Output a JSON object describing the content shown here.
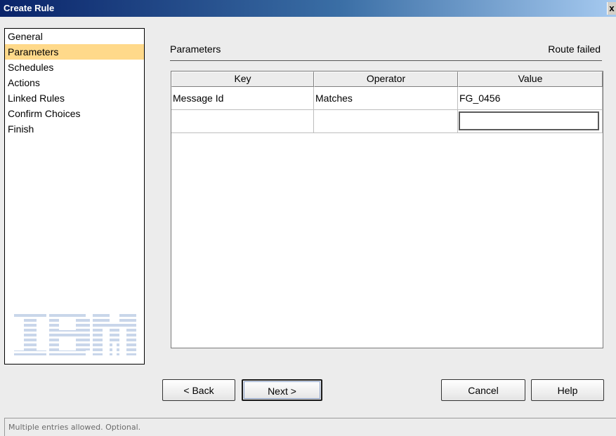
{
  "window": {
    "title": "Create Rule",
    "close_label": "x"
  },
  "nav": {
    "items": [
      {
        "label": "General"
      },
      {
        "label": "Parameters"
      },
      {
        "label": "Schedules"
      },
      {
        "label": "Actions"
      },
      {
        "label": "Linked Rules"
      },
      {
        "label": "Confirm Choices"
      },
      {
        "label": "Finish"
      }
    ],
    "selected": "Parameters",
    "logo": "IBM"
  },
  "section": {
    "title": "Parameters",
    "status": "Route failed"
  },
  "table": {
    "columns": [
      "Key",
      "Operator",
      "Value"
    ],
    "rows": [
      {
        "key": "Message Id",
        "operator": "Matches",
        "value": "FG_0456"
      },
      {
        "key": "",
        "operator": "",
        "value": ""
      }
    ]
  },
  "buttons": {
    "back": "< Back",
    "next": "Next >",
    "cancel": "Cancel",
    "help": "Help"
  },
  "status_bar": {
    "text": "Multiple entries allowed. Optional."
  },
  "colors": {
    "selection": "#ffd98a",
    "title_bar": "#0a246a"
  }
}
